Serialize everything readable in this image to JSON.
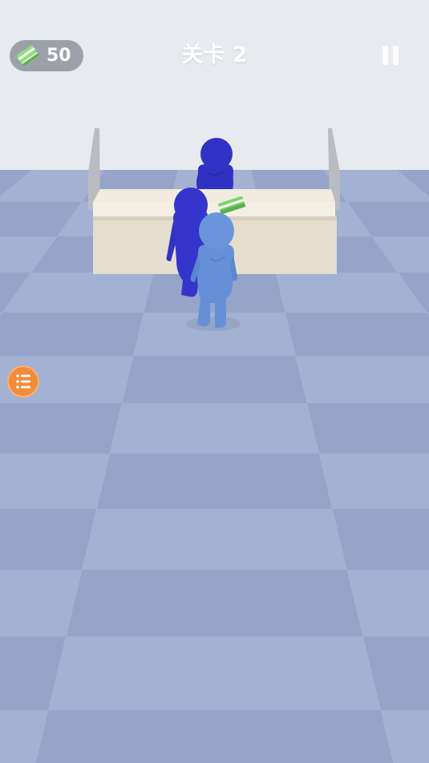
{
  "hud": {
    "cash_icon": "banknote-stack-icon",
    "cash_value": "50",
    "level_title": "关卡 2",
    "pause_icon": "pause-icon"
  },
  "side": {
    "list_icon": "list-menu-icon"
  },
  "colors": {
    "floor_light": "#a3b1d2",
    "floor_dark": "#95a4c8",
    "counter": "#ece6d8",
    "cashier": "#2e31c4",
    "customer_waiting": "#3435cc",
    "player": "#6590d8",
    "list_button": "#f08c3c",
    "money": "#7ed36a"
  }
}
